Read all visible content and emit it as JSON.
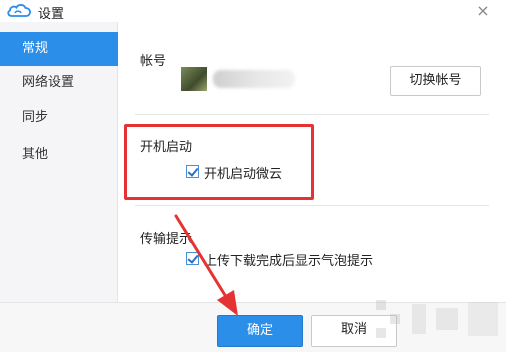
{
  "window": {
    "title": "设置",
    "close_glyph": "×",
    "logo_icon": "cloud-icon"
  },
  "sidebar": {
    "items": [
      {
        "label": "常规",
        "active": true
      },
      {
        "label": "网络设置",
        "active": false
      },
      {
        "label": "同步",
        "active": false
      },
      {
        "label": "其他",
        "active": false
      }
    ]
  },
  "account": {
    "section_label": "帐号",
    "switch_button": "切换帐号"
  },
  "startup": {
    "section_label": "开机启动",
    "checkbox_label": "开机启动微云",
    "checked": true
  },
  "transfer": {
    "section_label": "传输提示",
    "checkbox_label": "上传下载完成后显示气泡提示",
    "checked": true
  },
  "footer": {
    "ok_label": "确定",
    "cancel_label": "取消"
  },
  "colors": {
    "accent": "#2b8ee8",
    "highlight": "#e53333"
  }
}
